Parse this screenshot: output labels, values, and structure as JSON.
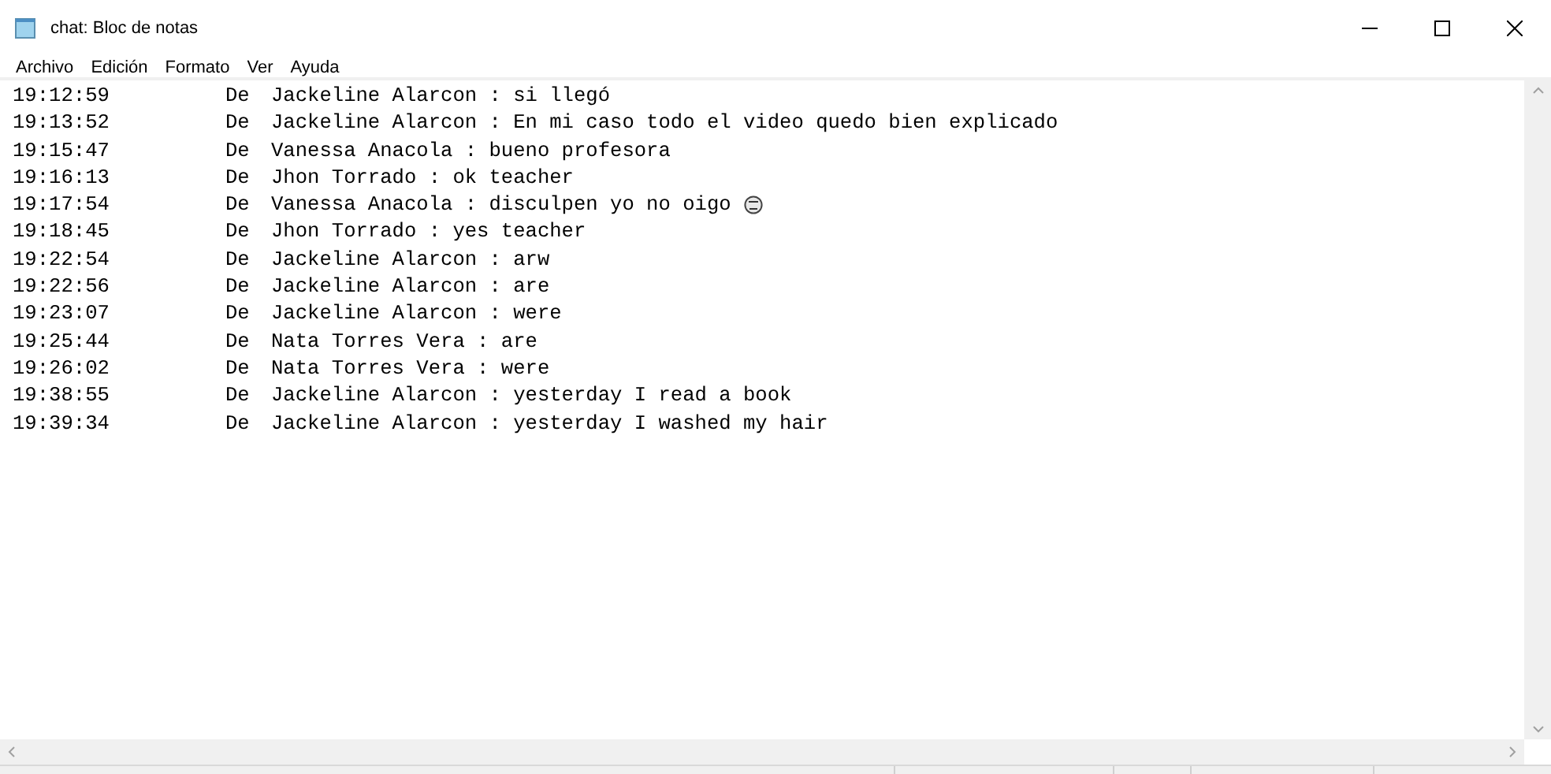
{
  "window": {
    "title": "chat: Bloc de notas"
  },
  "menu": [
    "Archivo",
    "Edición",
    "Formato",
    "Ver",
    "Ayuda"
  ],
  "lines": [
    {
      "time": "19:12:59",
      "label": "De",
      "message": "Jackeline Alarcon : si llegó"
    },
    {
      "time": "19:13:52",
      "label": "De",
      "message": "Jackeline Alarcon : En mi caso todo el video quedo bien explicado"
    },
    {
      "time": "19:15:47",
      "label": "De",
      "message": "Vanessa Anacola : bueno profesora"
    },
    {
      "time": "19:16:13",
      "label": "De",
      "message": "Jhon Torrado : ok teacher"
    },
    {
      "time": "19:17:54",
      "label": "De",
      "message": "Vanessa Anacola : disculpen yo no oigo",
      "emoji": true
    },
    {
      "time": "19:18:45",
      "label": "De",
      "message": "Jhon Torrado : yes teacher"
    },
    {
      "time": "19:22:54",
      "label": "De",
      "message": "Jackeline Alarcon : arw"
    },
    {
      "time": "19:22:56",
      "label": "De",
      "message": "Jackeline Alarcon : are"
    },
    {
      "time": "19:23:07",
      "label": "De",
      "message": "Jackeline Alarcon : were"
    },
    {
      "time": "19:25:44",
      "label": "De",
      "message": "Nata Torres Vera : are"
    },
    {
      "time": "19:26:02",
      "label": "De",
      "message": "Nata Torres Vera : were"
    },
    {
      "time": "19:38:55",
      "label": "De",
      "message": "Jackeline Alarcon : yesterday I read a book"
    },
    {
      "time": "19:39:34",
      "label": "De",
      "message": "Jackeline Alarcon : yesterday I washed my hair"
    }
  ]
}
